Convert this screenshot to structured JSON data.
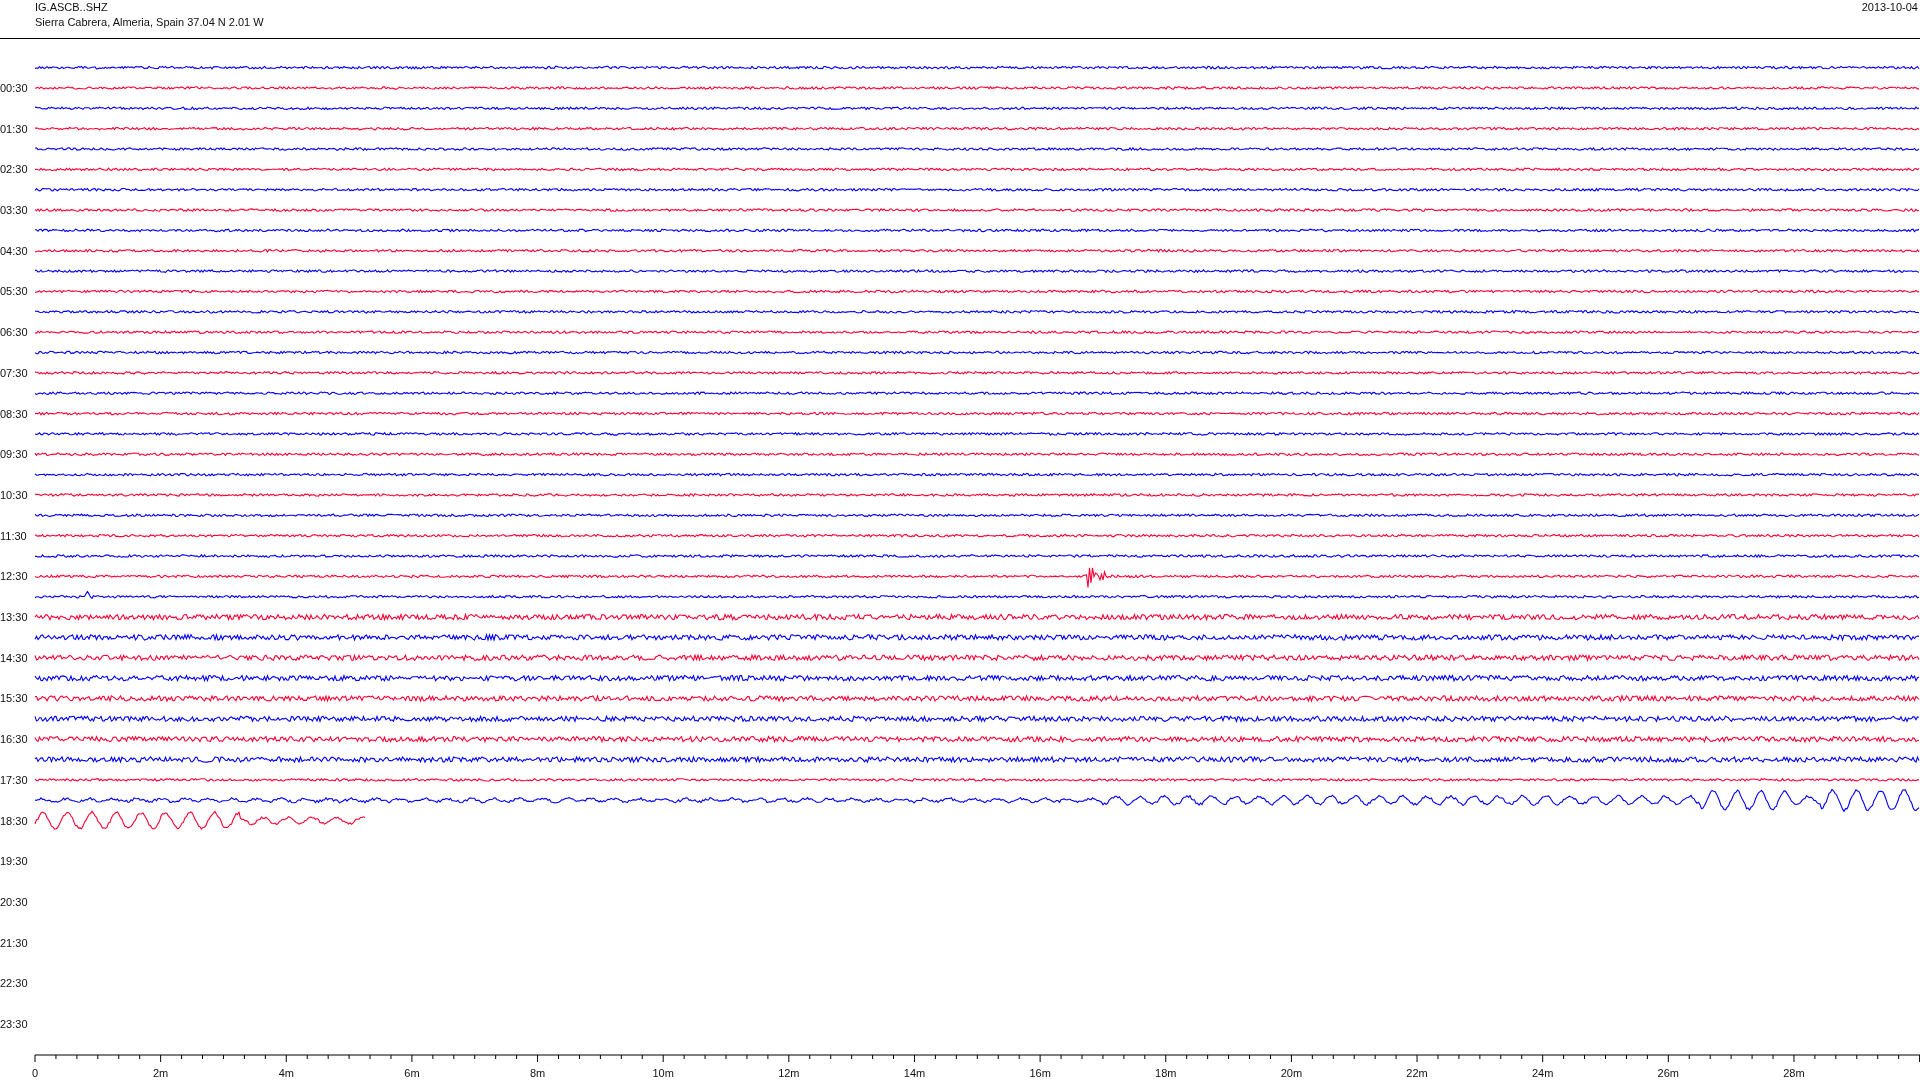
{
  "header": {
    "station": "IG.ASCB..SHZ",
    "location": "Sierra Cabrera, Almeria, Spain  37.04 N 2.01 W",
    "date": "2013-10-04"
  },
  "time_labels": [
    "00:30",
    "01:30",
    "02:30",
    "03:30",
    "04:30",
    "05:30",
    "06:30",
    "07:30",
    "08:30",
    "09:30",
    "10:30",
    "11:30",
    "12:30",
    "13:30",
    "14:30",
    "15:30",
    "16:30",
    "17:30",
    "18:30",
    "19:30",
    "20:30",
    "21:30",
    "22:30",
    "23:30"
  ],
  "x_axis_labels": [
    "0",
    "2m",
    "4m",
    "6m",
    "8m",
    "10m",
    "12m",
    "14m",
    "16m",
    "18m",
    "20m",
    "22m",
    "24m",
    "26m",
    "28m"
  ]
}
